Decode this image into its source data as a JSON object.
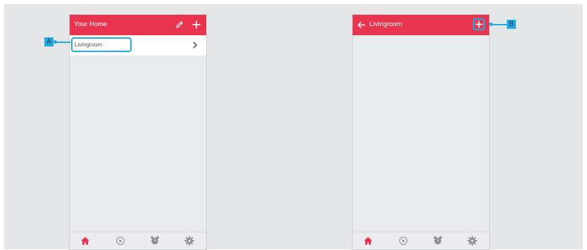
{
  "left_screen": {
    "header_title": "Your Home",
    "room_item": {
      "label": "Livingroom"
    }
  },
  "right_screen": {
    "header_title": "Livingroom"
  },
  "callouts": {
    "a": "A",
    "b": "B"
  },
  "tabbar_icons": [
    "home-icon",
    "play-icon",
    "alarm-icon",
    "settings-icon"
  ],
  "colors": {
    "accent": "#e8344e",
    "highlight": "#27a8df",
    "background": "#e5e6e8"
  }
}
